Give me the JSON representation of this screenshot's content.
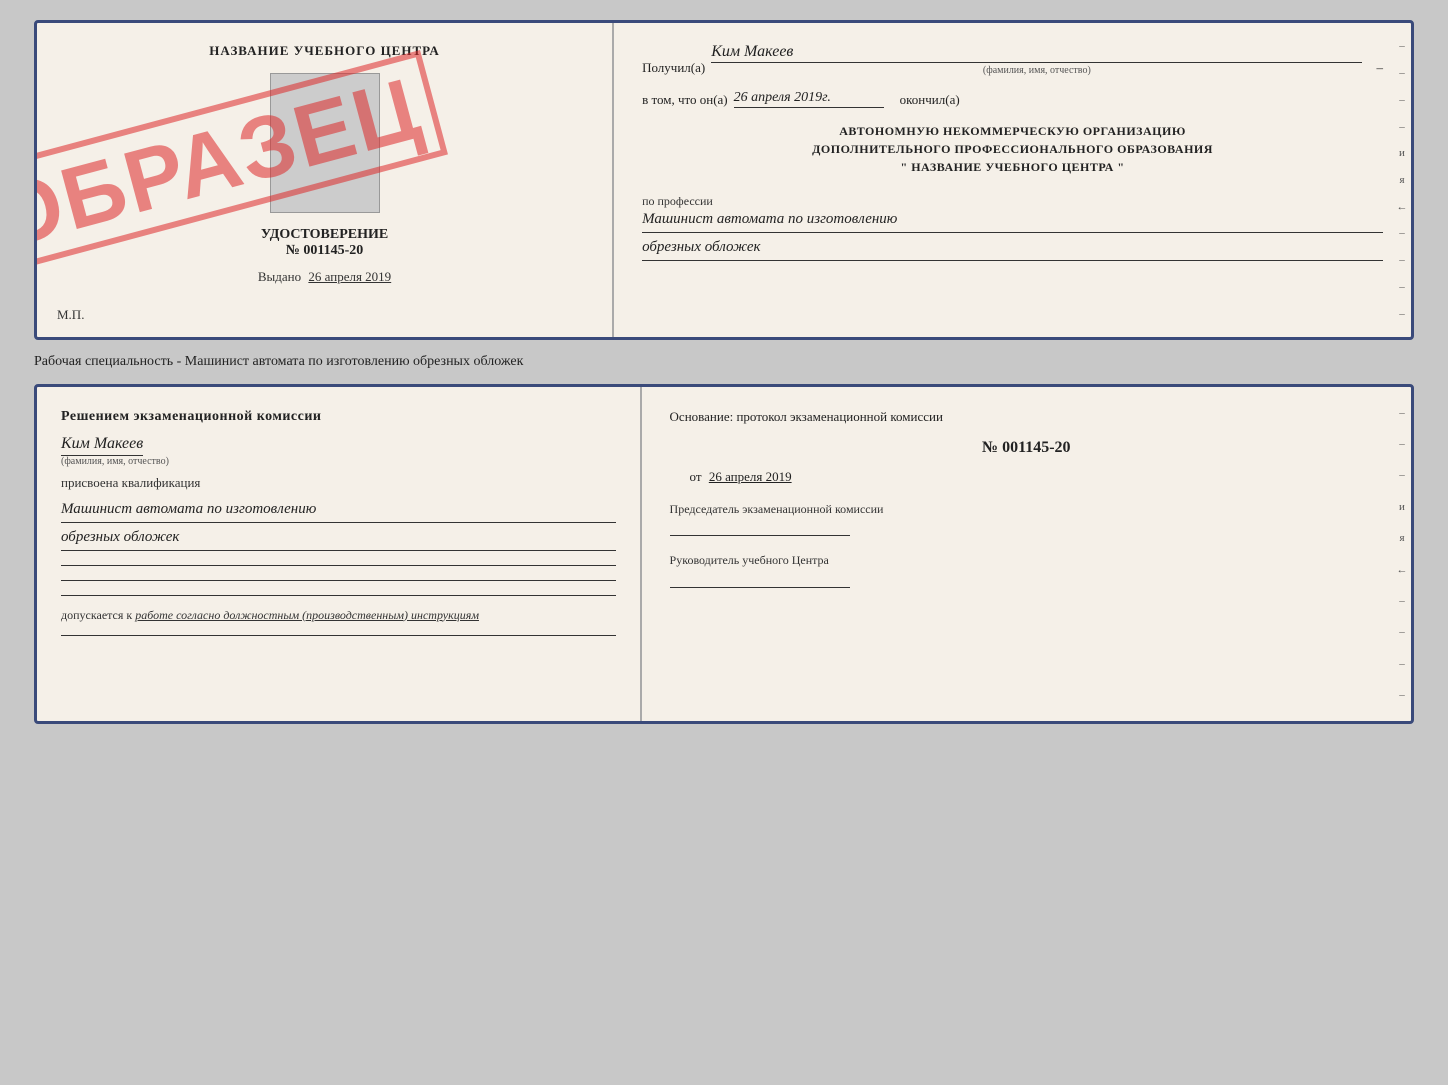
{
  "cert": {
    "left": {
      "title": "НАЗВАНИЕ УЧЕБНОГО ЦЕНТРА",
      "id_label": "УДОСТОВЕРЕНИЕ",
      "id_number": "№ 001145-20",
      "issued_label": "Выдано",
      "issued_date": "26 апреля 2019",
      "mp_label": "М.П.",
      "stamp": "ОБРАЗЕЦ"
    },
    "right": {
      "received_label": "Получил(а)",
      "received_name": "Ким Макеев",
      "received_sub": "(фамилия, имя, отчество)",
      "in_that_label": "в том, что он(а)",
      "in_that_date": "26 апреля 2019г.",
      "finished_label": "окончил(а)",
      "org_line1": "АВТОНОМНУЮ НЕКОММЕРЧЕСКУЮ ОРГАНИЗАЦИЮ",
      "org_line2": "ДОПОЛНИТЕЛЬНОГО ПРОФЕССИОНАЛЬНОГО ОБРАЗОВАНИЯ",
      "org_line3": "\" НАЗВАНИЕ УЧЕБНОГО ЦЕНТРА \"",
      "profession_label": "по профессии",
      "profession_line1": "Машинист автомата по изготовлению",
      "profession_line2": "обрезных обложек",
      "side_dashes": [
        "-",
        "-",
        "-",
        "-",
        "и",
        "я",
        "←",
        "-",
        "-",
        "-",
        "-"
      ]
    }
  },
  "subtitle": "Рабочая специальность - Машинист автомата по изготовлению обрезных обложек",
  "exam": {
    "left": {
      "decision_label": "Решением экзаменационной комиссии",
      "name_value": "Ким Макеев",
      "name_sub": "(фамилия, имя, отчество)",
      "qual_label": "присвоена квалификация",
      "qual_line1": "Машинист автомата по изготовлению",
      "qual_line2": "обрезных обложек",
      "allows_label": "допускается к",
      "allows_value": "работе согласно должностным (производственным) инструкциям"
    },
    "right": {
      "basis_label": "Основание: протокол экзаменационной комиссии",
      "number": "№ 001145-20",
      "date_prefix": "от",
      "date_value": "26 апреля 2019",
      "chairman_label": "Председатель экзаменационной комиссии",
      "director_label": "Руководитель учебного Центра",
      "side_dashes": [
        "-",
        "-",
        "-",
        "и",
        "я",
        "←",
        "-",
        "-",
        "-",
        "-"
      ]
    }
  }
}
